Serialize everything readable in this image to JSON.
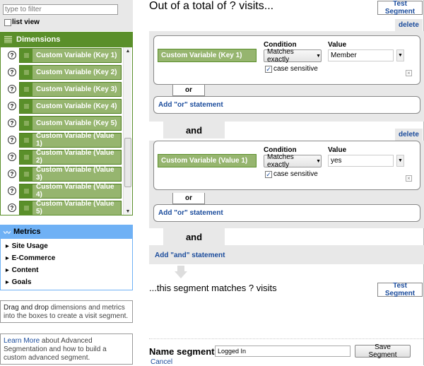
{
  "filter": {
    "placeholder": "type to filter",
    "list_view_label": "list view",
    "list_view_checked": false
  },
  "dimensions": {
    "header": "Dimensions",
    "items": [
      {
        "label": "Custom Variable (Key 1)"
      },
      {
        "label": "Custom Variable (Key 2)"
      },
      {
        "label": "Custom Variable (Key 3)"
      },
      {
        "label": "Custom Variable (Key 4)"
      },
      {
        "label": "Custom Variable (Key 5)"
      },
      {
        "label": "Custom Variable (Value 1)"
      },
      {
        "label": "Custom Variable (Value 2)"
      },
      {
        "label": "Custom Variable (Value 3)"
      },
      {
        "label": "Custom Variable (Value 4)"
      },
      {
        "label": "Custom Variable (Value 5)"
      }
    ],
    "help_glyph": "?"
  },
  "metrics": {
    "header": "Metrics",
    "items": [
      {
        "label": "Site Usage"
      },
      {
        "label": "E-Commerce"
      },
      {
        "label": "Content"
      },
      {
        "label": "Goals"
      }
    ]
  },
  "help": {
    "drag_prefix": "Drag and drop",
    "drag_rest": " dimensions and metrics into the boxes to create a visit segment.",
    "learn_link": "Learn More",
    "learn_rest": " about Advanced Segmentation and how to build a custom advanced segment."
  },
  "main": {
    "title": "Out of a total of ? visits...",
    "test_segment_label": "Test Segment",
    "delete_label": "delete",
    "condition_label": "Condition",
    "value_label": "Value",
    "case_sensitive_label": "case sensitive",
    "or_label": "or",
    "and_label": "and",
    "add_or_label": "Add \"or\" statement",
    "add_and_label": "Add \"and\" statement",
    "conditions": [
      {
        "dimension": "Custom Variable (Key 1)",
        "operator": "Matches exactly",
        "value": "Member",
        "case_sensitive": true
      },
      {
        "dimension": "Custom Variable (Value 1)",
        "operator": "Matches exactly",
        "value": "yes",
        "case_sensitive": true
      }
    ],
    "matches_text": "...this segment matches ? visits",
    "name_segment_label": "Name segment:",
    "name_segment_value": "Logged In",
    "save_label": "Save Segment",
    "cancel_label": "Cancel"
  }
}
